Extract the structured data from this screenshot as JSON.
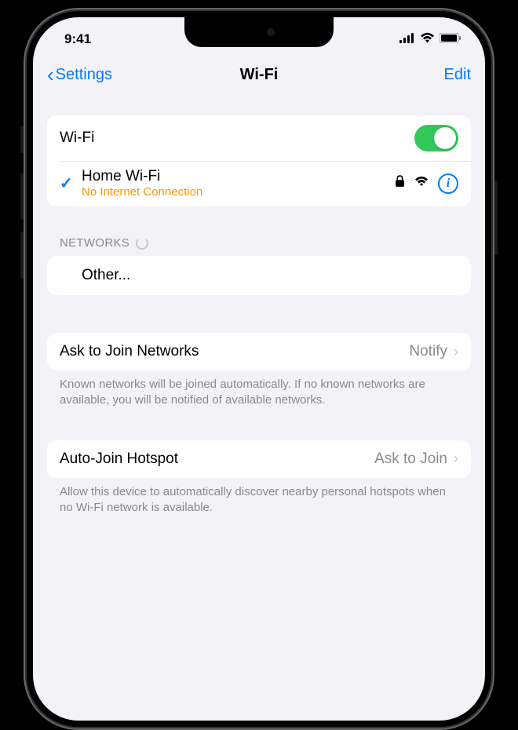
{
  "status_bar": {
    "time": "9:41"
  },
  "nav": {
    "back_label": "Settings",
    "title": "Wi-Fi",
    "edit_label": "Edit"
  },
  "wifi_toggle": {
    "label": "Wi-Fi"
  },
  "connected": {
    "name": "Home Wi-Fi",
    "status": "No Internet Connection"
  },
  "networks": {
    "header": "NETWORKS",
    "other_label": "Other..."
  },
  "ask_join": {
    "label": "Ask to Join Networks",
    "value": "Notify",
    "footer": "Known networks will be joined automatically. If no known networks are available, you will be notified of available networks."
  },
  "auto_hotspot": {
    "label": "Auto-Join Hotspot",
    "value": "Ask to Join",
    "footer": "Allow this device to automatically discover nearby personal hotspots when no Wi-Fi network is available."
  }
}
